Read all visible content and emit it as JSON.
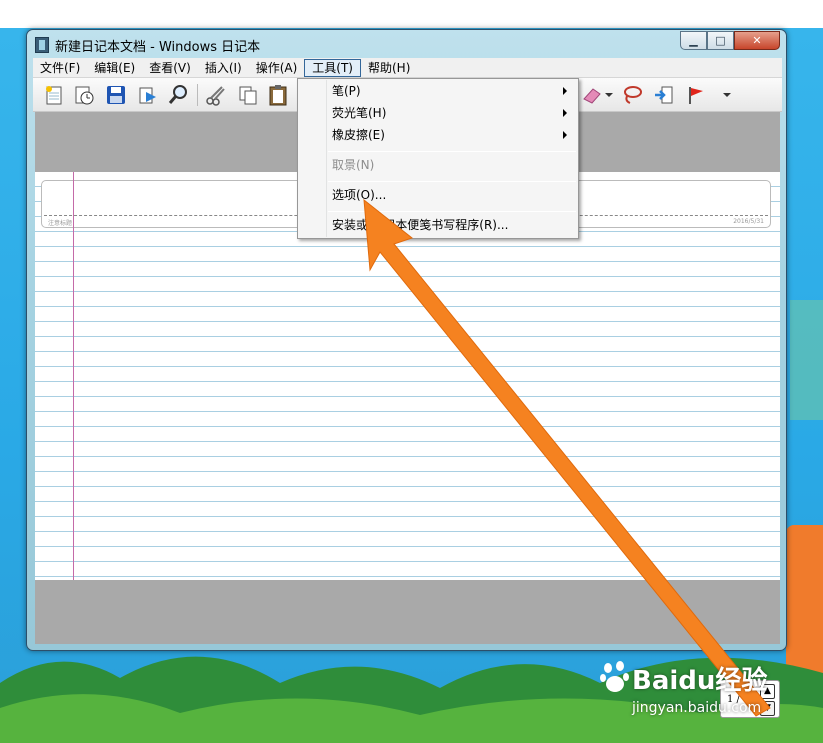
{
  "window": {
    "title": "新建日记本文档 - Windows 日记本",
    "minimize": "▁",
    "maximize": "□",
    "close": "✕"
  },
  "menubar": [
    {
      "label": "文件(F)"
    },
    {
      "label": "编辑(E)"
    },
    {
      "label": "查看(V)"
    },
    {
      "label": "插入(I)"
    },
    {
      "label": "操作(A)"
    },
    {
      "label": "工具(T)",
      "active": true
    },
    {
      "label": "帮助(H)"
    }
  ],
  "tools_menu": {
    "pen": "笔(P)",
    "highlighter": "荧光笔(H)",
    "eraser": "橡皮擦(E)",
    "capture": "取景(N)",
    "options": "选项(O)...",
    "install": "安装或... 记本便笺书写程序(R)..."
  },
  "page_header": {
    "left_text": "注意标题",
    "right_text": "2016/5/31"
  },
  "pager": {
    "text": "1 / 1",
    "up": "▲",
    "down": "▼"
  },
  "watermark": {
    "brand": "Baidu经验",
    "url": "jingyan.baidu.com"
  },
  "colors": {
    "accent_arrow": "#f58220",
    "rule_line": "#a9cfe2",
    "margin_line": "#c46aa8"
  }
}
